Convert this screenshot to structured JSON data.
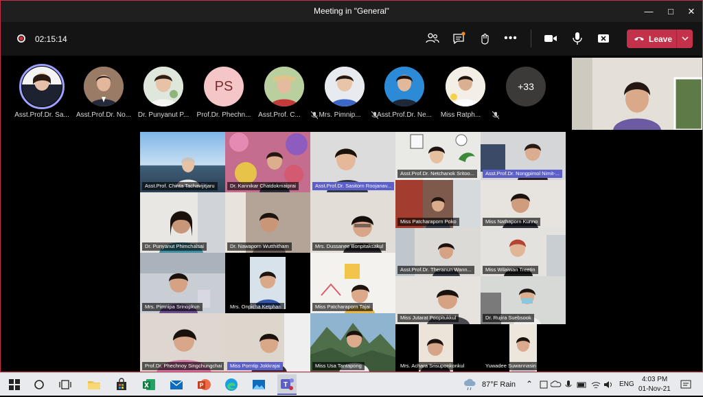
{
  "window": {
    "title": "Meeting in \"General\""
  },
  "toolbar": {
    "timer": "02:15:14",
    "leave_label": "Leave"
  },
  "strip": {
    "participants": [
      {
        "name": "Asst.Prof.Dr. Sa...",
        "muted": false,
        "initials": ""
      },
      {
        "name": "Asst.Prof.Dr. No...",
        "muted": false,
        "initials": ""
      },
      {
        "name": "Dr. Punyanut P...",
        "muted": false,
        "initials": ""
      },
      {
        "name": "Prof.Dr. Phechn...",
        "muted": false,
        "initials": "PS"
      },
      {
        "name": "Asst.Prof. C...",
        "muted": true,
        "initials": ""
      },
      {
        "name": "Mrs. Pimnip...",
        "muted": true,
        "initials": ""
      },
      {
        "name": "Asst.Prof.Dr. Ne...",
        "muted": false,
        "initials": ""
      },
      {
        "name": "Miss Ratph...",
        "muted": true,
        "initials": ""
      }
    ],
    "overflow": "+33"
  },
  "grid": {
    "tiles": [
      "Asst.Prof. Chinta Tachavijitjaru",
      "Dr. Kannikar Chatdokmaiprai",
      "Asst.Prof.Dr. Sasitorn Roojanav...",
      "Asst.Prof.Dr. Netchanok Sritoo...",
      "Asst.Prof.Dr. Nongpimol Nimit-...",
      "Dr. Punyanut Phimchaisai",
      "Dr. Nawaporn Wutthitham",
      "Mrs. Dussanee Bonpitaksakul",
      "Miss Patcharaporn Poko",
      "Miss Nathaporn Kunno",
      "Asst.Prof.Dr. Theranun Wann...",
      "Miss Wilaiwan Treetin",
      "Mrs. Pimnipa Srinopkun",
      "Mrs. Onpicha Ketphan",
      "Miss Patcharaporn Tajai",
      "Miss Jutarat Poopitukkul",
      "Dr. Rujira Suebsook",
      "Prof.Dr. Phechnoy Singchungchai",
      "Miss Porntip Jokkrajai",
      "Miss Usa Tantapong",
      "Mrs. Achara Srisuponkonkul",
      "Yuwadee Suwannasiri"
    ]
  },
  "taskbar": {
    "weather": "87°F  Rain",
    "language": "ENG",
    "time": "4:03 PM",
    "date": "01-Nov-21"
  },
  "colors": {
    "accent": "#5b5fc7",
    "leave": "#c4314b",
    "window_border": "#c4314b"
  }
}
